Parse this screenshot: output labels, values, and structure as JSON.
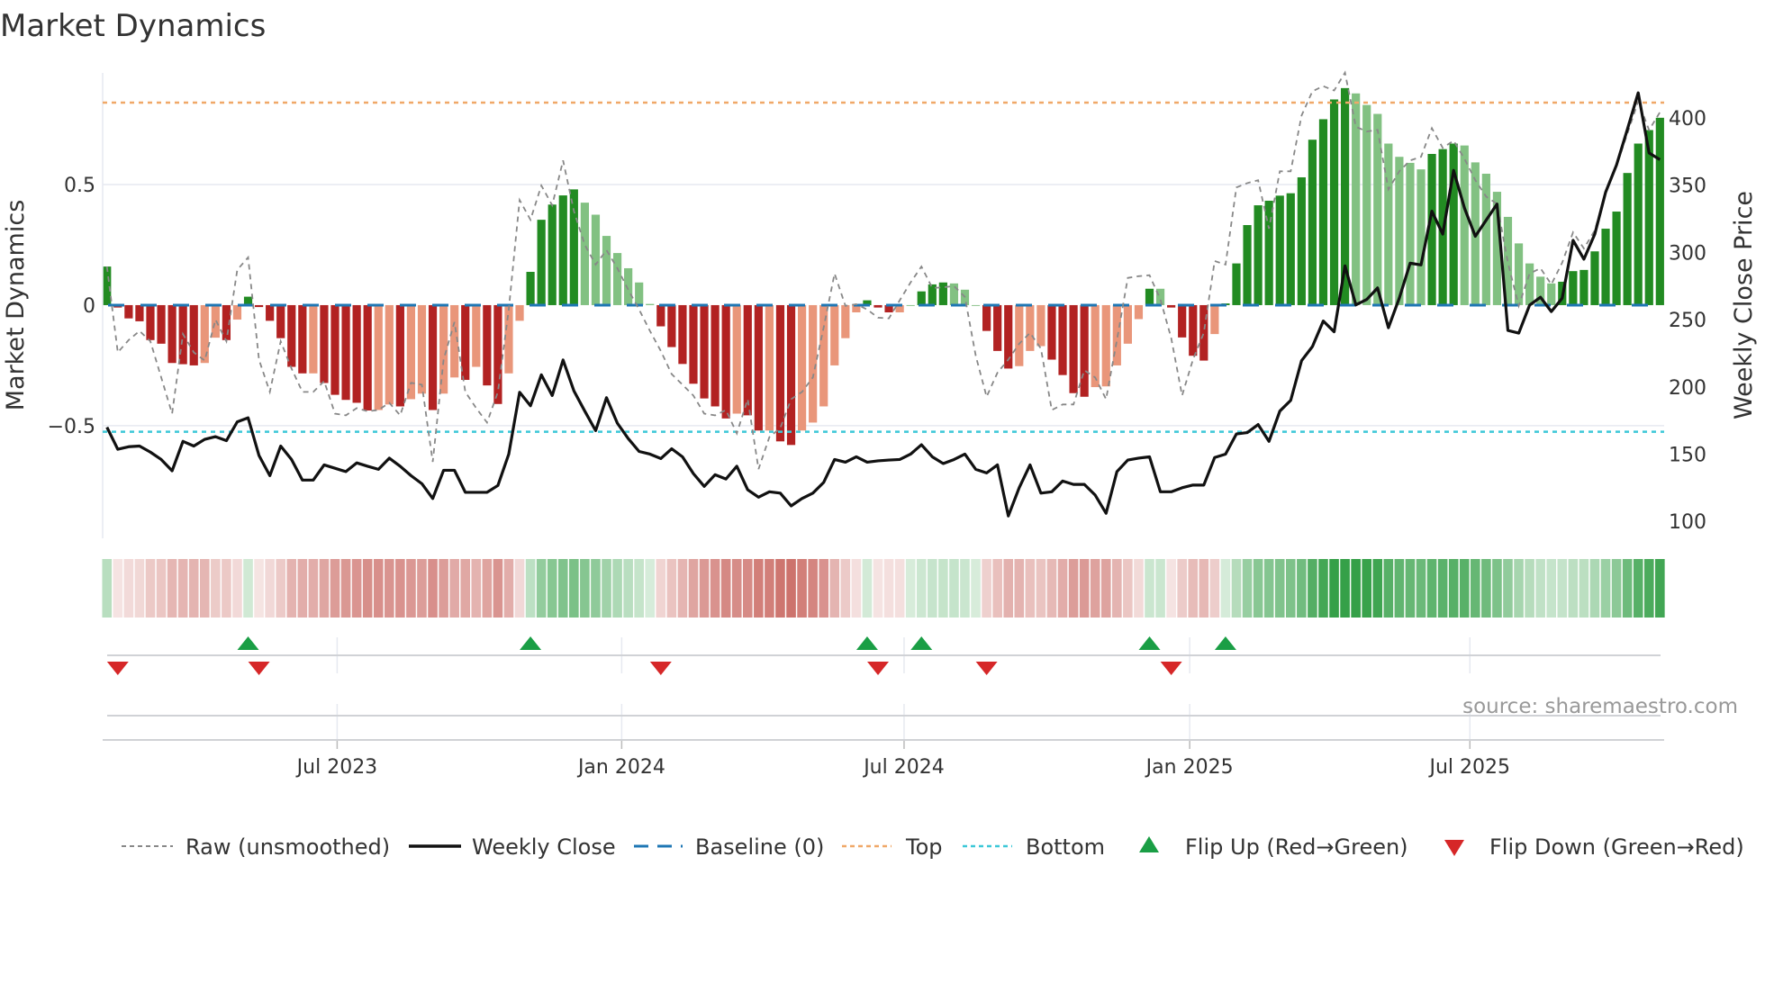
{
  "title": "Market Dynamics",
  "source": "source: sharemaestro.com",
  "colors": {
    "dark_green": "#228b22",
    "light_green": "#82c182",
    "dark_red": "#b22222",
    "light_red": "#e9967a",
    "baseline": "#1f77b4",
    "top": "#f0a868",
    "bottom": "#3cc8d8",
    "close": "#111111",
    "raw": "#888888",
    "flip_up": "#1a9e45",
    "flip_down": "#d62728",
    "heat_green": "#35a048",
    "heat_red": "#cc6f69"
  },
  "chart_data": {
    "type": "bar",
    "title": "Market Dynamics",
    "ylabel": "Market Dynamics",
    "y2label": "Weekly Close Price",
    "ylim": [
      -0.967,
      0.963
    ],
    "y2lim": [
      87.4,
      433.5
    ],
    "yticks": [
      {
        "label": "0.5",
        "value": 0.5
      },
      {
        "label": "0",
        "value": 0
      },
      {
        "label": "−0.5",
        "value": -0.5
      }
    ],
    "y2ticks": [
      {
        "label": "100",
        "value": 100
      },
      {
        "label": "150",
        "value": 150
      },
      {
        "label": "200",
        "value": 200
      },
      {
        "label": "250",
        "value": 250
      },
      {
        "label": "300",
        "value": 300
      },
      {
        "label": "350",
        "value": 350
      },
      {
        "label": "400",
        "value": 400
      }
    ],
    "x_ticks": [
      {
        "label": "Jul 2023",
        "week": 21.2
      },
      {
        "label": "Jan 2024",
        "week": 47.4
      },
      {
        "label": "Jul 2024",
        "week": 73.4
      },
      {
        "label": "Jan 2025",
        "week": 99.7
      },
      {
        "label": "Jul 2025",
        "week": 125.5
      }
    ],
    "top_level": 0.84,
    "bottom_level": -0.525,
    "baseline": 0,
    "grid": true,
    "legend_position": "bottom",
    "legend": [
      "Raw (unsmoothed)",
      "Weekly Close",
      "Baseline (0)",
      "Top",
      "Bottom",
      "Flip Up (Red→Green)",
      "Flip Down (Green→Red)"
    ],
    "series": [
      {
        "name": "Market Dynamics (smoothed)",
        "type": "bar",
        "values": [
          0.16,
          -0.01,
          -0.055,
          -0.067,
          -0.145,
          -0.16,
          -0.24,
          -0.245,
          -0.25,
          -0.24,
          -0.135,
          -0.145,
          -0.06,
          0.035,
          -0.008,
          -0.065,
          -0.137,
          -0.256,
          -0.283,
          -0.283,
          -0.323,
          -0.372,
          -0.393,
          -0.405,
          -0.437,
          -0.435,
          -0.412,
          -0.42,
          -0.39,
          -0.367,
          -0.435,
          -0.367,
          -0.3,
          -0.31,
          -0.256,
          -0.333,
          -0.41,
          -0.283,
          -0.065,
          0.138,
          0.354,
          0.417,
          0.455,
          0.48,
          0.425,
          0.375,
          0.287,
          0.216,
          0.153,
          0.094,
          0.005,
          -0.088,
          -0.174,
          -0.244,
          -0.326,
          -0.387,
          -0.42,
          -0.47,
          -0.45,
          -0.457,
          -0.52,
          -0.52,
          -0.565,
          -0.58,
          -0.52,
          -0.487,
          -0.42,
          -0.25,
          -0.137,
          -0.03,
          0.02,
          -0.01,
          -0.03,
          -0.03,
          0.0,
          0.057,
          0.086,
          0.094,
          0.09,
          0.064,
          0.0,
          -0.107,
          -0.19,
          -0.263,
          -0.253,
          -0.19,
          -0.17,
          -0.226,
          -0.29,
          -0.365,
          -0.38,
          -0.34,
          -0.337,
          -0.25,
          -0.16,
          -0.058,
          0.068,
          0.068,
          -0.01,
          -0.134,
          -0.21,
          -0.23,
          -0.12,
          0.007,
          0.173,
          0.332,
          0.414,
          0.433,
          0.454,
          0.464,
          0.53,
          0.686,
          0.771,
          0.853,
          0.9,
          0.878,
          0.83,
          0.793,
          0.67,
          0.615,
          0.59,
          0.563,
          0.627,
          0.647,
          0.67,
          0.662,
          0.592,
          0.545,
          0.47,
          0.366,
          0.256,
          0.173,
          0.118,
          0.09,
          0.097,
          0.141,
          0.146,
          0.223,
          0.317,
          0.388,
          0.548,
          0.67,
          0.726,
          0.777
        ]
      },
      {
        "name": "Raw (unsmoothed)",
        "type": "line",
        "values": [
          0.16,
          -0.196,
          -0.145,
          -0.107,
          -0.15,
          -0.3,
          -0.45,
          -0.12,
          -0.196,
          -0.23,
          -0.06,
          -0.15,
          0.146,
          0.198,
          -0.226,
          -0.36,
          -0.15,
          -0.263,
          -0.36,
          -0.36,
          -0.315,
          -0.45,
          -0.457,
          -0.427,
          -0.44,
          -0.435,
          -0.405,
          -0.457,
          -0.322,
          -0.33,
          -0.65,
          -0.226,
          -0.07,
          -0.36,
          -0.427,
          -0.487,
          -0.36,
          -0.018,
          0.436,
          0.354,
          0.496,
          0.414,
          0.6,
          0.39,
          0.25,
          0.168,
          0.228,
          0.153,
          0.064,
          -0.018,
          -0.107,
          -0.19,
          -0.286,
          -0.33,
          -0.375,
          -0.45,
          -0.457,
          -0.435,
          -0.532,
          -0.39,
          -0.68,
          -0.547,
          -0.51,
          -0.39,
          -0.36,
          -0.3,
          -0.092,
          0.131,
          -0.003,
          0.004,
          -0.018,
          -0.052,
          -0.055,
          0.02,
          0.094,
          0.16,
          0.071,
          0.074,
          0.079,
          0.034,
          -0.21,
          -0.38,
          -0.28,
          -0.226,
          -0.16,
          -0.115,
          -0.18,
          -0.435,
          -0.412,
          -0.412,
          -0.27,
          -0.3,
          -0.39,
          -0.145,
          0.113,
          0.12,
          0.124,
          0.024,
          -0.137,
          -0.375,
          -0.226,
          -0.115,
          0.183,
          0.168,
          0.488,
          0.506,
          0.518,
          0.317,
          0.555,
          0.555,
          0.786,
          0.887,
          0.908,
          0.89,
          0.964,
          0.74,
          0.72,
          0.727,
          0.48,
          0.555,
          0.6,
          0.615,
          0.734,
          0.652,
          0.682,
          0.607,
          0.518,
          0.45,
          0.42,
          0.176,
          -0.003,
          0.131,
          0.153,
          0.086,
          0.176,
          0.302,
          0.235,
          0.31,
          0.466,
          0.578,
          0.711,
          0.845,
          0.726,
          0.8
        ]
      },
      {
        "name": "Weekly Close",
        "type": "line",
        "axis": "right",
        "values": [
          170,
          153.6,
          155.5,
          156,
          151.5,
          146,
          137.6,
          159.5,
          156,
          161,
          163,
          160,
          174,
          177,
          149,
          134,
          156,
          146,
          130.7,
          130.7,
          142,
          139.5,
          137,
          143.5,
          141,
          138.7,
          147,
          141,
          134,
          128,
          117,
          138,
          138,
          121.6,
          121.6,
          121.6,
          126.7,
          150,
          196,
          186,
          209,
          193.6,
          220,
          197,
          182,
          167.5,
          192,
          173,
          161.6,
          152,
          150,
          146.7,
          154,
          148,
          135.5,
          126,
          134.7,
          131.5,
          141,
          123.5,
          118,
          122,
          121,
          111.5,
          117,
          121,
          129,
          146,
          144,
          148,
          144,
          145,
          145.6,
          146,
          150,
          157,
          148,
          143,
          146,
          150,
          138.7,
          136,
          142,
          104,
          125,
          142,
          121,
          122,
          130,
          127.5,
          127.5,
          119.5,
          106,
          137,
          145.6,
          147,
          148,
          122,
          122,
          125,
          127,
          127,
          147.5,
          150,
          165,
          166,
          172,
          159.5,
          182,
          190,
          219.5,
          230,
          249,
          241,
          290,
          261,
          265,
          273.6,
          244,
          266,
          292,
          290.7,
          330.7,
          313.6,
          361,
          333,
          312,
          324,
          336,
          242,
          240,
          260.8,
          266.7,
          256,
          266,
          309,
          295,
          313.6,
          344.8,
          365,
          391.5,
          418.7,
          374,
          369
        ]
      }
    ],
    "flip_up_weeks": [
      13,
      39,
      70,
      75,
      96,
      103
    ],
    "flip_down_weeks": [
      1,
      14,
      51,
      71,
      81,
      98
    ]
  }
}
